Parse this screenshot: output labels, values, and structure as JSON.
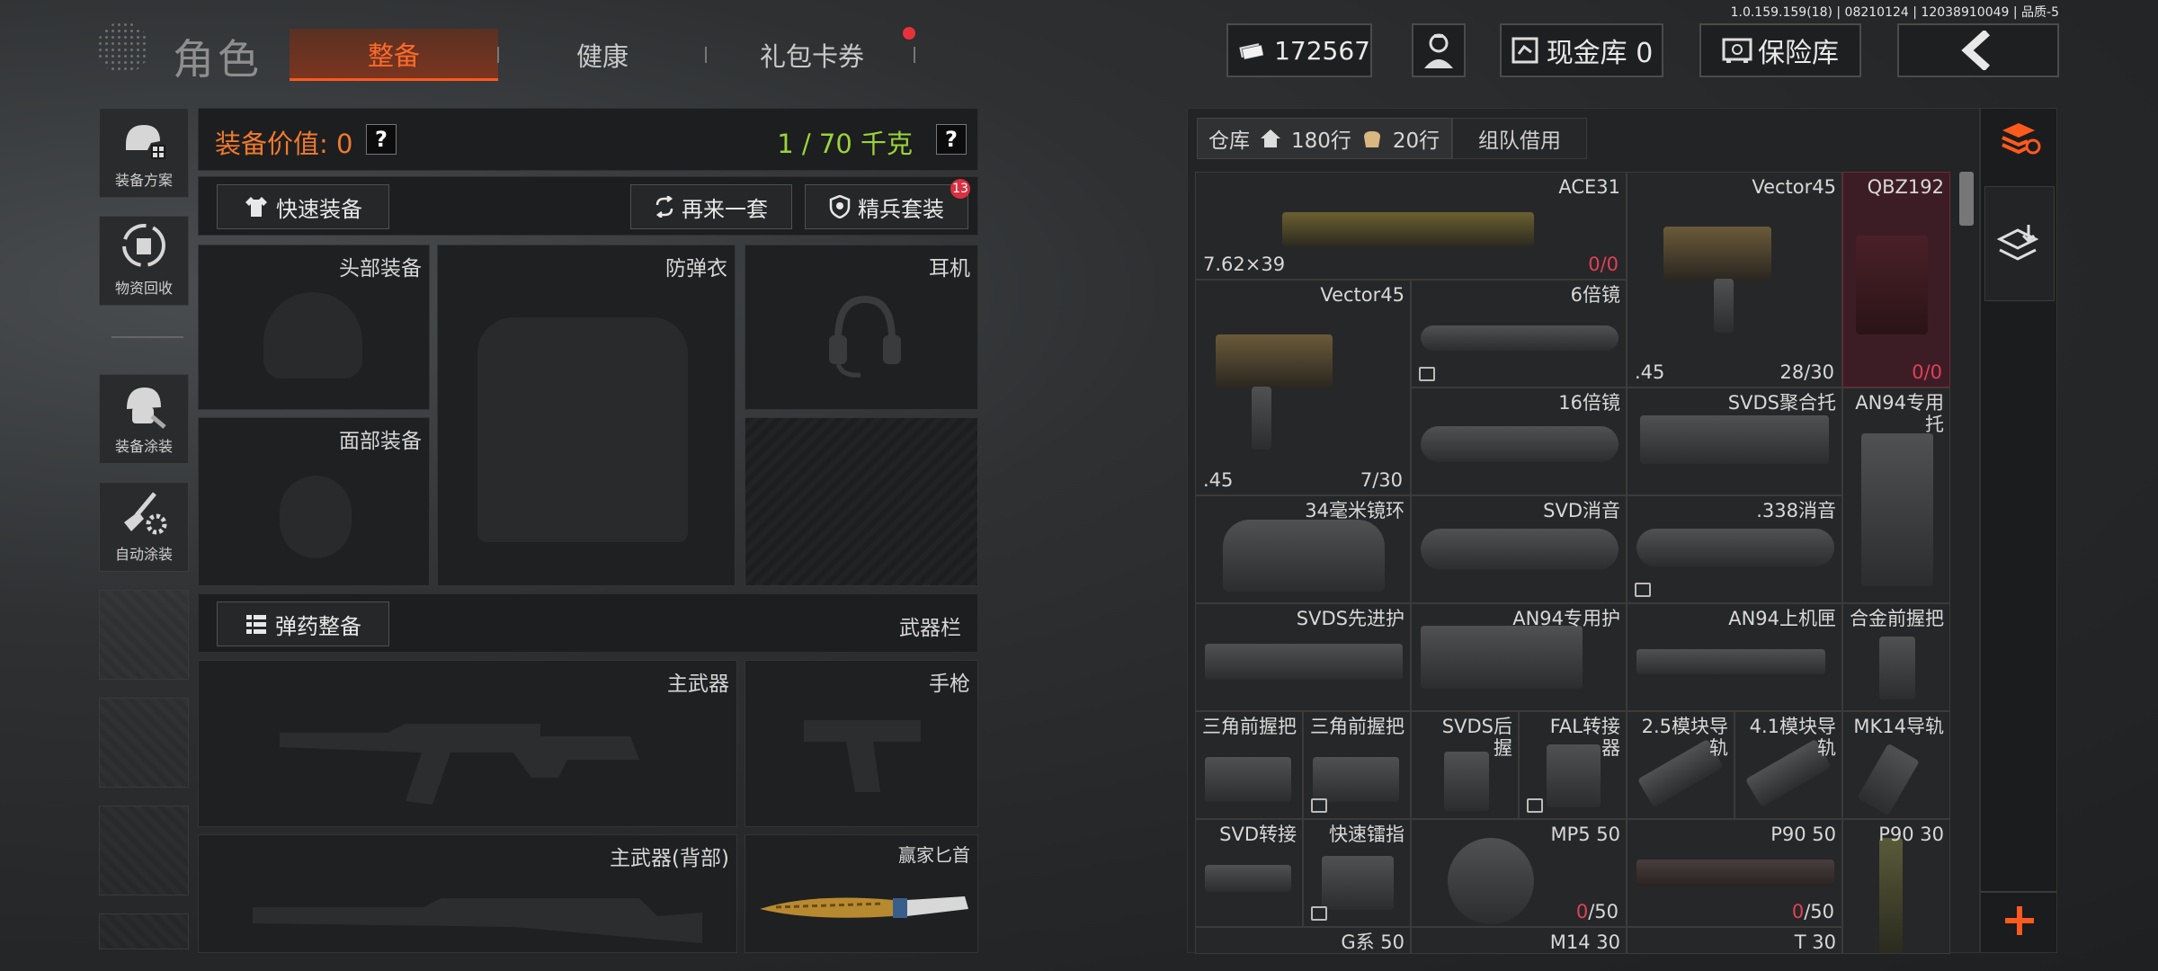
{
  "build_info": "1.0.159.159(18) | 08210124 | 12038910049 | 品质-5",
  "header": {
    "title": "角色",
    "tabs": [
      {
        "label": "整备",
        "active": true
      },
      {
        "label": "健康",
        "active": false
      },
      {
        "label": "礼包卡券",
        "active": false,
        "badge": true
      }
    ],
    "currency": "172567",
    "cash_vault": "现金库 0",
    "safe": "保险库"
  },
  "sidebar": {
    "items": [
      {
        "label": "装备方案"
      },
      {
        "label": "物资回收"
      },
      {
        "label": "装备涂装"
      },
      {
        "label": "自动涂装"
      }
    ]
  },
  "equipment": {
    "value_label": "装备价值: 0",
    "weight": "1 / 70 千克",
    "quick_equip": "快速装备",
    "again": "再来一套",
    "elite_set": "精兵套装",
    "elite_badge": "13",
    "slots": {
      "head": "头部装备",
      "armor": "防弹衣",
      "headset": "耳机",
      "face": "面部装备"
    },
    "ammo_btn": "弹药整备",
    "weapon_bar": "武器栏",
    "weapons": {
      "primary": "主武器",
      "pistol": "手枪",
      "primary_back": "主武器(背部)",
      "knife": "赢家匕首"
    }
  },
  "warehouse": {
    "tab_label": "仓库",
    "rows_a": "180行",
    "rows_b": "20行",
    "team_borrow": "组队借用",
    "cells": {
      "ace31": {
        "name": "ACE31",
        "caliber": "7.62×39",
        "ammo_cur": "0",
        "ammo_max": "/0"
      },
      "vector45a": {
        "name": "Vector45",
        "caliber": ".45",
        "ammo": "28/30"
      },
      "qbz192": {
        "name": "QBZ192",
        "ammo_cur": "0",
        "ammo_max": "/0"
      },
      "vector45b": {
        "name": "Vector45",
        "caliber": ".45",
        "ammo": "7/30"
      },
      "scope6": {
        "name": "6倍镜"
      },
      "scope16": {
        "name": "16倍镜"
      },
      "svds_stock": {
        "name": "SVDS聚合托"
      },
      "an94_stock": {
        "name": "AN94专用\n托"
      },
      "ring34": {
        "name": "34毫米镜环"
      },
      "svd_supp": {
        "name": "SVD消音"
      },
      "supp338": {
        "name": ".338消音"
      },
      "svds_hg": {
        "name": "SVDS先进护"
      },
      "an94_hg": {
        "name": "AN94专用护"
      },
      "an94_rcv": {
        "name": "AN94上机匣"
      },
      "alloy_grip": {
        "name": "合金前握把"
      },
      "tri_grip1": {
        "name": "三角前握把"
      },
      "tri_grip2": {
        "name": "三角前握把"
      },
      "svds_grip": {
        "name": "SVDS后\n握"
      },
      "fal_conv": {
        "name": "FAL转接\n器"
      },
      "rail25": {
        "name": "2.5模块导\n轨"
      },
      "rail41": {
        "name": "4.1模块导\n轨"
      },
      "mk14": {
        "name": "MK14导轨"
      },
      "svd_conv": {
        "name": "SVD转接"
      },
      "quick_mag": {
        "name": "快速镭指"
      },
      "mp5": {
        "name": "MP5 50",
        "ammo_cur": "0",
        "ammo_max": "/50"
      },
      "p90_50": {
        "name": "P90 50",
        "ammo_cur": "0",
        "ammo_max": "/50"
      },
      "p90_30": {
        "name": "P90 30"
      },
      "g50": {
        "name": "G系 50"
      },
      "m14_30": {
        "name": "M14 30"
      },
      "t30": {
        "name": "T 30"
      }
    }
  }
}
